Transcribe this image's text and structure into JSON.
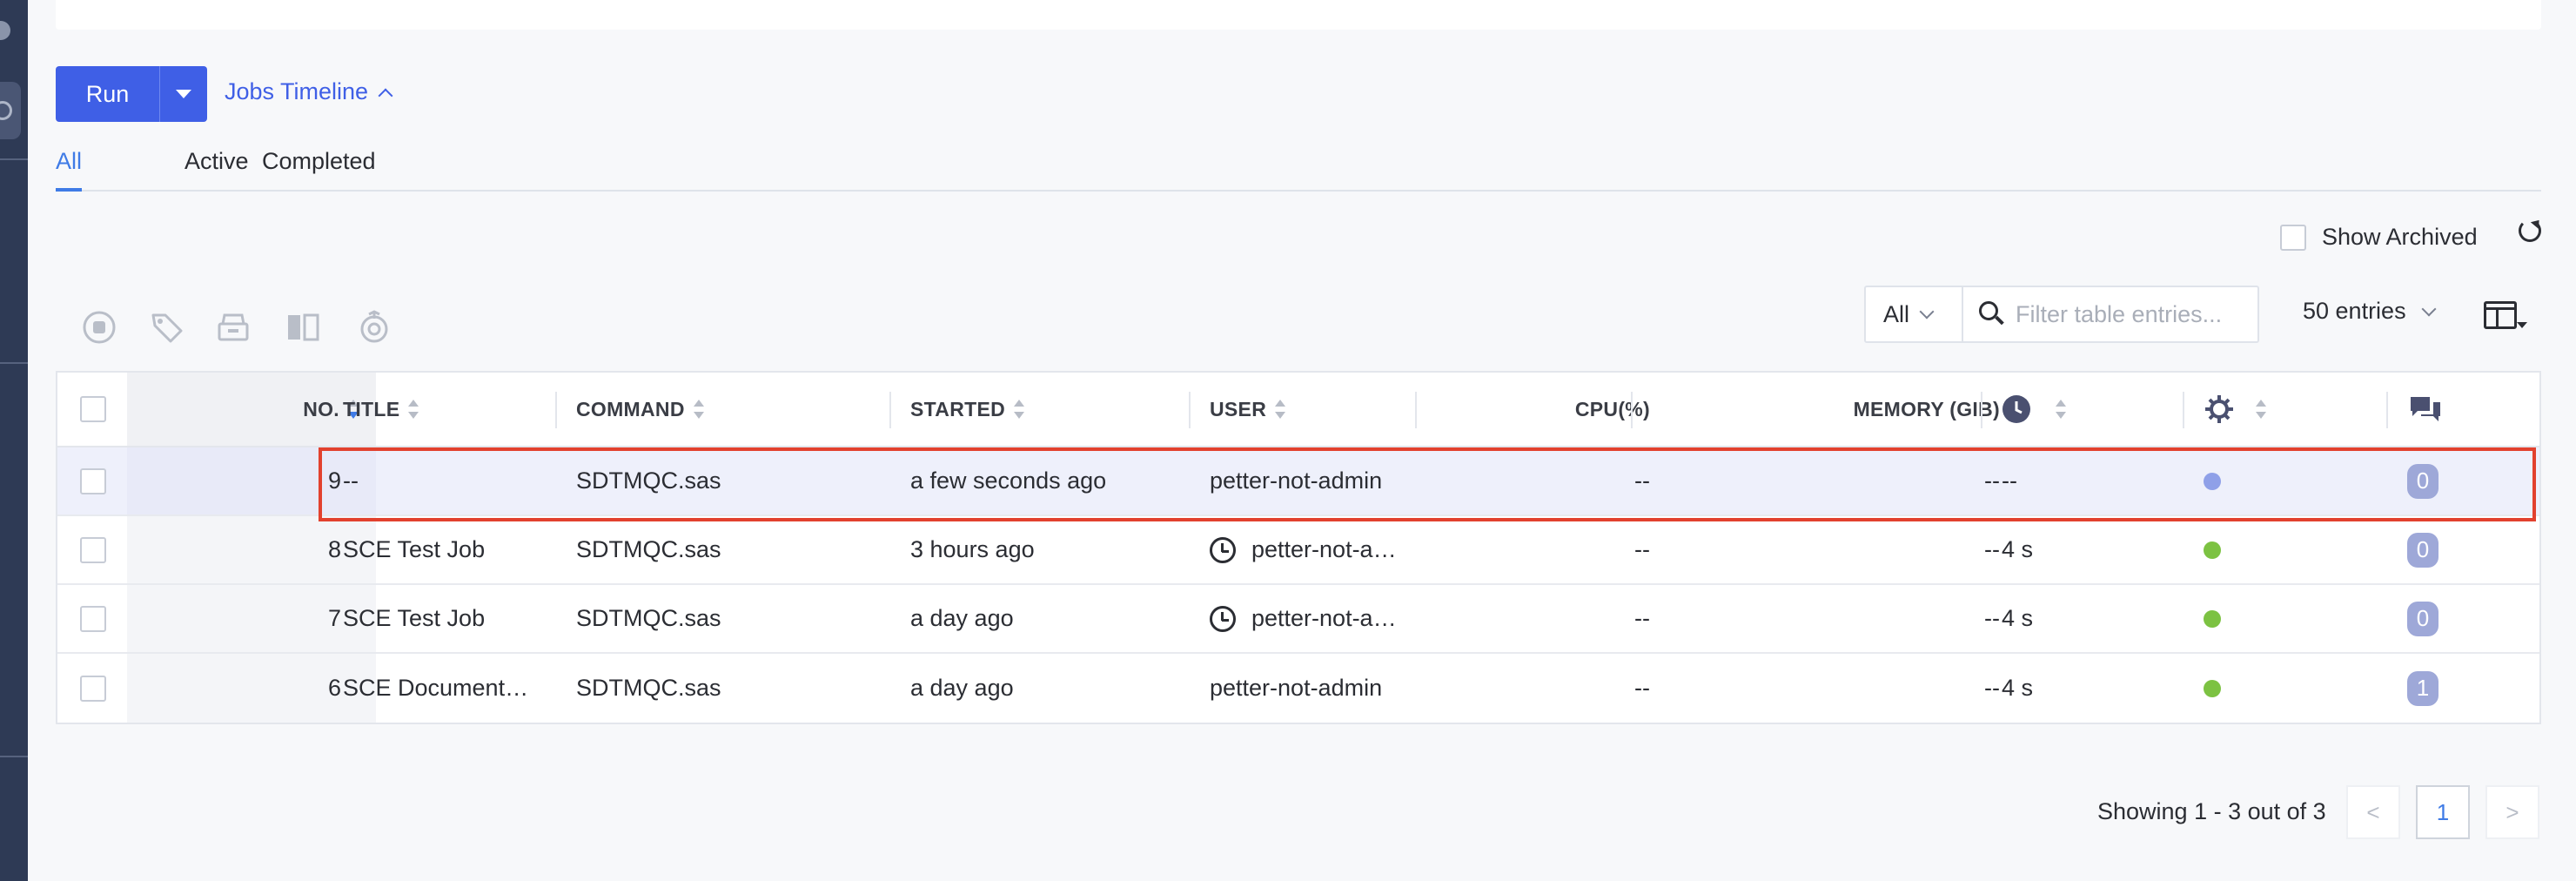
{
  "toolbar": {
    "run_label": "Run",
    "jobs_timeline_label": "Jobs Timeline"
  },
  "tabs": [
    {
      "label": "All",
      "active": true
    },
    {
      "label": "Active",
      "active": false
    },
    {
      "label": "Completed",
      "active": false
    }
  ],
  "show_archived_label": "Show Archived",
  "filter": {
    "scope_value": "All",
    "placeholder": "Filter table entries..."
  },
  "entries_label": "50 entries",
  "table": {
    "columns": {
      "no": "NO.",
      "title": "TITLE",
      "command": "COMMAND",
      "started": "STARTED",
      "user": "USER",
      "cpu": "CPU(%)",
      "memory": "MEMORY (GIB)"
    },
    "rows": [
      {
        "no": "9",
        "title": "--",
        "command": "SDTMQC.sas",
        "started": "a few seconds ago",
        "user": "petter-not-admin",
        "cpu": "--",
        "memory": "--",
        "duration": "--",
        "comments": "0"
      },
      {
        "no": "8",
        "title": "SCE Test Job",
        "command": "SDTMQC.sas",
        "started": "3 hours ago",
        "user": "petter-not-a…",
        "cpu": "--",
        "memory": "--",
        "duration": "4 s",
        "comments": "0"
      },
      {
        "no": "7",
        "title": "SCE Test Job",
        "command": "SDTMQC.sas",
        "started": "a day ago",
        "user": "petter-not-a…",
        "cpu": "--",
        "memory": "--",
        "duration": "4 s",
        "comments": "0"
      },
      {
        "no": "6",
        "title": "SCE Document…",
        "command": "SDTMQC.sas",
        "started": "a day ago",
        "user": "petter-not-admin",
        "cpu": "--",
        "memory": "--",
        "duration": "4 s",
        "comments": "1"
      }
    ]
  },
  "pagination": {
    "summary": "Showing 1 - 3 out of 3",
    "prev": "<",
    "current_page": "1",
    "next": ">"
  },
  "colors": {
    "accent": "#3f5fe6",
    "link": "#3f7be6",
    "status_running": "#8fa0e8",
    "status_done": "#7cc242",
    "highlight_border": "#e2412e",
    "sidebar": "#2e3a55"
  }
}
